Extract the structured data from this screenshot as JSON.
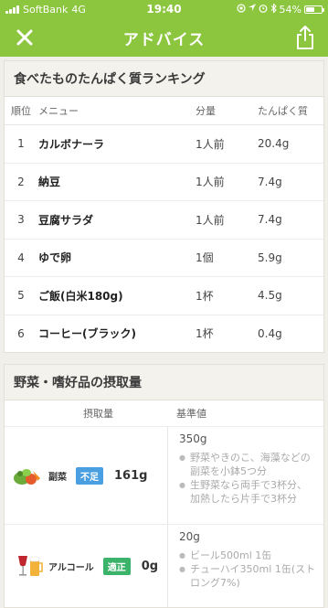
{
  "status_bar": {
    "carrier": "SoftBank",
    "network": "4G",
    "time": "19:40",
    "battery": "54%",
    "battery_level": 0.54
  },
  "navbar": {
    "title": "アドバイス",
    "close_icon": "close-icon",
    "share_icon": "share-icon"
  },
  "ranking": {
    "title": "食べたものたんぱく質ランキング",
    "columns": {
      "rank": "順位",
      "menu": "メニュー",
      "amount": "分量",
      "protein": "たんぱく質"
    },
    "rows": [
      {
        "rank": "1",
        "menu": "カルボナーラ",
        "amount": "1人前",
        "protein": "20.4g"
      },
      {
        "rank": "2",
        "menu": "納豆",
        "amount": "1人前",
        "protein": "7.4g"
      },
      {
        "rank": "3",
        "menu": "豆腐サラダ",
        "amount": "1人前",
        "protein": "7.4g"
      },
      {
        "rank": "4",
        "menu": "ゆで卵",
        "amount": "1個",
        "protein": "5.9g"
      },
      {
        "rank": "5",
        "menu": "ご飯(白米180g)",
        "amount": "1杯",
        "protein": "4.5g"
      },
      {
        "rank": "6",
        "menu": "コーヒー(ブラック)",
        "amount": "1杯",
        "protein": "0.4g"
      }
    ]
  },
  "intake": {
    "title": "野菜・嗜好品の摂取量",
    "columns": {
      "intake": "摂取量",
      "standard": "基準値"
    },
    "rows": [
      {
        "label": "副菜",
        "badge": "不足",
        "badge_color": "#4a9fe0",
        "amount": "161g",
        "standard": "350g",
        "examples": [
          "野菜やきのこ、海藻などの副菜を小鉢5つ分",
          "生野菜なら両手で3杯分、加熱したら片手で3杯分"
        ]
      },
      {
        "label": "アルコール",
        "badge": "適正",
        "badge_color": "#3cb36a",
        "amount": "0g",
        "standard": "20g",
        "examples": [
          "ビール500ml 1缶",
          "チューハイ350ml 1缶(ストロング7%)"
        ]
      }
    ]
  }
}
